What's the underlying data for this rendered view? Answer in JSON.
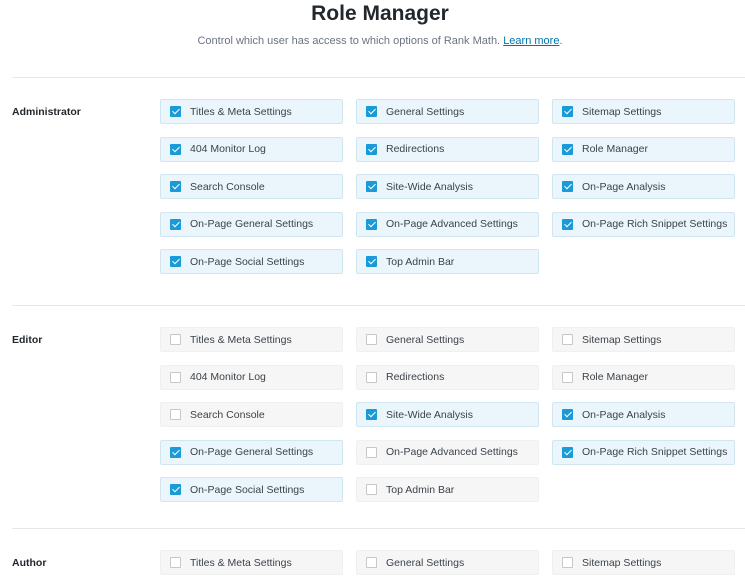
{
  "header": {
    "title": "Role Manager",
    "subtitle": "Control which user has access to which options of Rank Math.",
    "learn_more": "Learn more",
    "subtitle_end": "."
  },
  "roles": [
    {
      "name": "Administrator",
      "items": [
        {
          "label": "Titles & Meta Settings",
          "checked": true
        },
        {
          "label": "General Settings",
          "checked": true
        },
        {
          "label": "Sitemap Settings",
          "checked": true
        },
        {
          "label": "404 Monitor Log",
          "checked": true
        },
        {
          "label": "Redirections",
          "checked": true
        },
        {
          "label": "Role Manager",
          "checked": true
        },
        {
          "label": "Search Console",
          "checked": true
        },
        {
          "label": "Site-Wide Analysis",
          "checked": true
        },
        {
          "label": "On-Page Analysis",
          "checked": true
        },
        {
          "label": "On-Page General Settings",
          "checked": true
        },
        {
          "label": "On-Page Advanced Settings",
          "checked": true
        },
        {
          "label": "On-Page Rich Snippet Settings",
          "checked": true
        },
        {
          "label": "On-Page Social Settings",
          "checked": true
        },
        {
          "label": "Top Admin Bar",
          "checked": true
        }
      ]
    },
    {
      "name": "Editor",
      "items": [
        {
          "label": "Titles & Meta Settings",
          "checked": false
        },
        {
          "label": "General Settings",
          "checked": false
        },
        {
          "label": "Sitemap Settings",
          "checked": false
        },
        {
          "label": "404 Monitor Log",
          "checked": false
        },
        {
          "label": "Redirections",
          "checked": false
        },
        {
          "label": "Role Manager",
          "checked": false
        },
        {
          "label": "Search Console",
          "checked": false
        },
        {
          "label": "Site-Wide Analysis",
          "checked": true
        },
        {
          "label": "On-Page Analysis",
          "checked": true
        },
        {
          "label": "On-Page General Settings",
          "checked": true
        },
        {
          "label": "On-Page Advanced Settings",
          "checked": false
        },
        {
          "label": "On-Page Rich Snippet Settings",
          "checked": true
        },
        {
          "label": "On-Page Social Settings",
          "checked": true
        },
        {
          "label": "Top Admin Bar",
          "checked": false
        }
      ]
    },
    {
      "name": "Author",
      "items": [
        {
          "label": "Titles & Meta Settings",
          "checked": false
        },
        {
          "label": "General Settings",
          "checked": false
        },
        {
          "label": "Sitemap Settings",
          "checked": false
        }
      ]
    }
  ]
}
